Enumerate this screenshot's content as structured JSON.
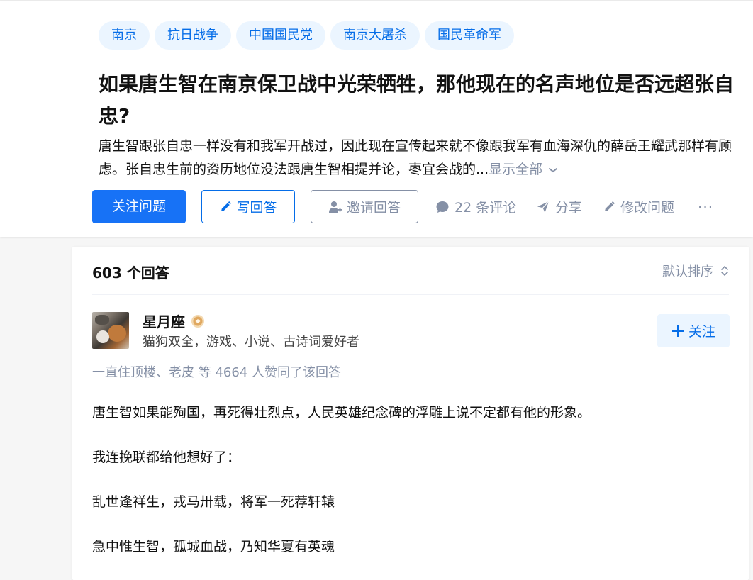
{
  "topics": [
    "南京",
    "抗日战争",
    "中国国民党",
    "南京大屠杀",
    "国民革命军"
  ],
  "question": {
    "title": "如果唐生智在南京保卫战中光荣牺牲，那他现在的名声地位是否远超张自忠?",
    "detail": "唐生智跟张自忠一样没有和我军开战过，因此现在宣传起来就不像跟我军有血海深仇的薛岳王耀武那样有顾虑。张自忠生前的资历地位没法跟唐生智相提并论，枣宜会战的...",
    "show_all": "显示全部"
  },
  "actions": {
    "follow_question": "关注问题",
    "write_answer": "写回答",
    "invite_answer": "邀请回答",
    "comments": "22 条评论",
    "share": "分享",
    "edit_question": "修改问题",
    "more": "···"
  },
  "answers": {
    "count_label": "603 个回答",
    "sort_label": "默认排序"
  },
  "answer": {
    "author_name": "星月座",
    "author_bio": "猫狗双全，游戏、小说、古诗词爱好者",
    "follow_label": "关注",
    "votes_text": "一直住顶楼、老皮 等 4664 人赞同了该回答",
    "paragraphs": [
      "唐生智如果能殉国，再死得壮烈点，人民英雄纪念碑的浮雕上说不定都有他的形象。",
      "我连挽联都给他想好了：",
      "乱世逢祥生，戎马卅载，将军一死荐轩辕",
      "急中惟生智，孤城血战，乃知华夏有英魂"
    ]
  },
  "colors": {
    "brand_blue": "#1772f6",
    "link_blue": "#056de8",
    "topic_bg": "#ebf5ff",
    "muted_gray": "#8590a6"
  }
}
